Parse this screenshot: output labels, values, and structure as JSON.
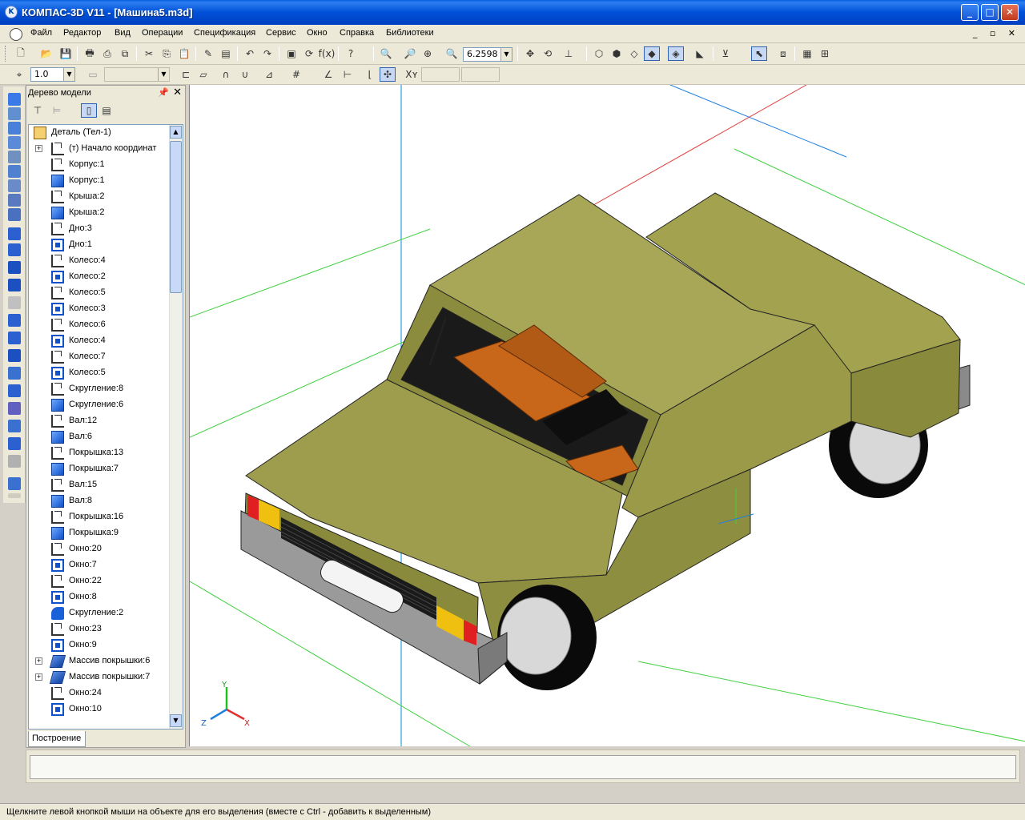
{
  "window": {
    "title": "КОМПАС-3D V11 - [Машина5.m3d]",
    "minimize": "_",
    "maximize": "□",
    "close": "✕"
  },
  "menu": {
    "items": [
      "Файл",
      "Редактор",
      "Вид",
      "Операции",
      "Спецификация",
      "Сервис",
      "Окно",
      "Справка",
      "Библиотеки"
    ],
    "mdi_controls": "_ ▫ ✕"
  },
  "toolbar": {
    "zoom_value": "6.2598",
    "step_value": "1.0"
  },
  "model_tree": {
    "title": "Дерево модели",
    "root": "Деталь (Тел-1)",
    "items": [
      {
        "label": "(т) Начало координат",
        "icon": "origin-icon",
        "expandable": true
      },
      {
        "label": "Корпус:1",
        "icon": "sketch-icon"
      },
      {
        "label": "Корпус:1",
        "icon": "extrude-icon"
      },
      {
        "label": "Крыша:2",
        "icon": "sketch-icon"
      },
      {
        "label": "Крыша:2",
        "icon": "extrude-icon"
      },
      {
        "label": "Дно:3",
        "icon": "sketch-icon"
      },
      {
        "label": "Дно:1",
        "icon": "cut-icon"
      },
      {
        "label": "Колесо:4",
        "icon": "sketch-icon"
      },
      {
        "label": "Колесо:2",
        "icon": "cut-icon"
      },
      {
        "label": "Колесо:5",
        "icon": "sketch-icon"
      },
      {
        "label": "Колесо:3",
        "icon": "cut-icon"
      },
      {
        "label": "Колесо:6",
        "icon": "sketch-icon"
      },
      {
        "label": "Колесо:4",
        "icon": "cut-icon"
      },
      {
        "label": "Колесо:7",
        "icon": "sketch-icon"
      },
      {
        "label": "Колесо:5",
        "icon": "cut-icon"
      },
      {
        "label": "Скругление:8",
        "icon": "sketch-icon"
      },
      {
        "label": "Скругление:6",
        "icon": "extrude-icon"
      },
      {
        "label": "Вал:12",
        "icon": "sketch-icon"
      },
      {
        "label": "Вал:6",
        "icon": "extrude-icon"
      },
      {
        "label": "Покрышка:13",
        "icon": "sketch-icon"
      },
      {
        "label": "Покрышка:7",
        "icon": "extrude-icon"
      },
      {
        "label": "Вал:15",
        "icon": "sketch-icon"
      },
      {
        "label": "Вал:8",
        "icon": "extrude-icon"
      },
      {
        "label": "Покрышка:16",
        "icon": "sketch-icon"
      },
      {
        "label": "Покрышка:9",
        "icon": "extrude-icon"
      },
      {
        "label": "Окно:20",
        "icon": "sketch-icon"
      },
      {
        "label": "Окно:7",
        "icon": "cut-icon"
      },
      {
        "label": "Окно:22",
        "icon": "sketch-icon"
      },
      {
        "label": "Окно:8",
        "icon": "cut-icon"
      },
      {
        "label": "Скругление:2",
        "icon": "fillet-icon"
      },
      {
        "label": "Окно:23",
        "icon": "sketch-icon"
      },
      {
        "label": "Окно:9",
        "icon": "cut-icon"
      },
      {
        "label": "Массив покрышки:6",
        "icon": "array-icon",
        "expandable": true
      },
      {
        "label": "Массив покрышки:7",
        "icon": "array-icon",
        "expandable": true
      },
      {
        "label": "Окно:24",
        "icon": "sketch-icon"
      },
      {
        "label": "Окно:10",
        "icon": "cut-icon"
      }
    ],
    "tab": "Построение"
  },
  "axes": {
    "x": "X",
    "y": "Y",
    "z": "Z"
  },
  "colors": {
    "body": "#9a9a4a",
    "body_top": "#a6a558",
    "interior": "#c8661a",
    "bumper": "#9a9a9a",
    "axis_red": "#e03030",
    "axis_green": "#20c020",
    "axis_blue": "#2080e0"
  },
  "status": {
    "text": "Щелкните левой кнопкой мыши на объекте для его выделения (вместе с Ctrl - добавить к выделенным)"
  }
}
